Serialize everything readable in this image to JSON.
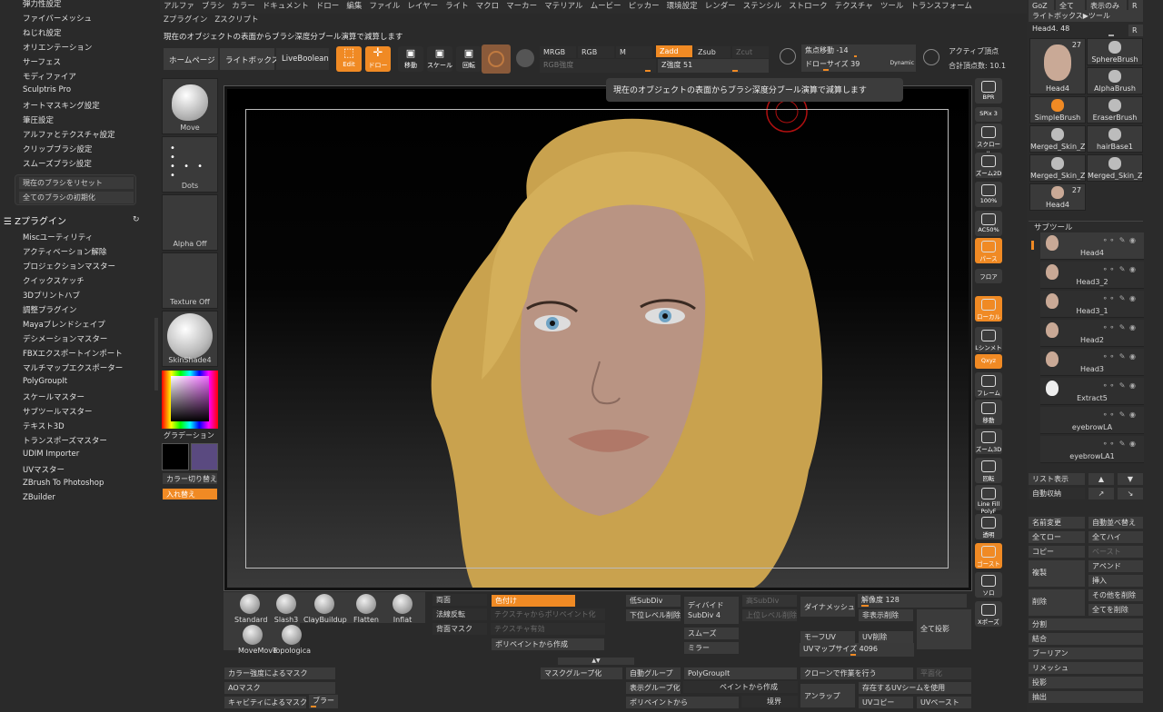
{
  "menubar": [
    "アルファ",
    "ブラシ",
    "カラー",
    "ドキュメント",
    "ドロー",
    "編集",
    "ファイル",
    "レイヤー",
    "ライト",
    "マクロ",
    "マーカー",
    "マテリアル",
    "ムービー",
    "ピッカー",
    "環境設定",
    "レンダー",
    "ステンシル",
    "ストローク",
    "テクスチャ",
    "ツール",
    "トランスフォーム",
    "Zプラグイン",
    "Zスクリプト"
  ],
  "hint": "現在のオブジェクトの表面からブラシ深度分ブール演算で減算します",
  "tooltip": "現在のオブジェクトの表面からブラシ深度分ブール演算で減算します",
  "left_menu": [
    "弾力性設定",
    "ファイバーメッシュ",
    "ねじれ設定",
    "オリエンテーション",
    "サーフェス",
    "モディファイア",
    "Sculptris Pro",
    "オートマスキング設定",
    "筆圧設定",
    "アルファとテクスチャ設定",
    "クリップブラシ設定",
    "スムーズブラシ設定"
  ],
  "reset": [
    "現在のブラシをリセット",
    "全てのブラシの初期化"
  ],
  "zplugin_title": "Zプラグイン",
  "plugins": [
    "Miscユーティリティ",
    "アクティベーション解除",
    "プロジェクションマスター",
    "クイックスケッチ",
    "3Dプリントハブ",
    "調整プラグイン",
    "Mayaブレンドシェイプ",
    "デシメーションマスター",
    "FBXエクスポートインポート",
    "マルチマップエクスポーター",
    "PolyGroupIt",
    "スケールマスター",
    "サブツールマスター",
    "テキスト3D",
    "トランスポーズマスター",
    "UDIM Importer",
    "UVマスター",
    "ZBrush To Photoshop",
    "ZBuilder"
  ],
  "shelf": {
    "home": "ホームページ",
    "lightbox": "ライトボックス",
    "liveboolean": "LiveBoolean",
    "edit": "Edit",
    "draw": "ドロー",
    "move": "移動",
    "scale": "スケール",
    "rotate": "回転",
    "mrgb": "MRGB",
    "rgb": "RGB",
    "m": "M",
    "zadd": "Zadd",
    "zsub": "Zsub",
    "zcut": "Zcut",
    "rgb_intensity": "RGB強度",
    "z_intensity": "Z強度 51",
    "focal": "焦点移動 -14",
    "draw_size": "ドローサイズ 39",
    "dynamic": "Dynamic",
    "active_points": "アクティブ頂点",
    "total_points": "合計頂点数: 10.1"
  },
  "left_tiles": {
    "move": "Move",
    "dots": "Dots",
    "alpha": "Alpha Off",
    "texture": "Texture Off",
    "material": "SkinShade4",
    "gradient": "グラデーション",
    "swap": "カラー切り替え",
    "replace": "入れ替え"
  },
  "right_tools": [
    "BPR",
    "SPix 3",
    "スクロール",
    "ズーム2D",
    "100%",
    "AC50%",
    "パース",
    "フロア",
    "ローカル",
    "Lシンメトリ",
    "Qxyz",
    "フレーム",
    "移動",
    "ズーム3D",
    "回転",
    "Line Fill PolyF",
    "透明",
    "ゴースト",
    "ソロ",
    "Xポーズ"
  ],
  "right_panel": {
    "goz": "GoZ",
    "all": "全て",
    "visible": "表示のみ",
    "r": "R",
    "lightbox_tool": "ライトボックス▶ツール",
    "head_name": "Head4. 48",
    "tools": [
      {
        "name": "Head4",
        "count": "27"
      },
      {
        "name": "SphereBrush"
      },
      {
        "name": "AlphaBrush"
      },
      {
        "name": "SimpleBrush"
      },
      {
        "name": "EraserBrush"
      },
      {
        "name": "Merged_Skin_ZS"
      },
      {
        "name": "hairBase1"
      },
      {
        "name": "Merged_Skin_ZS"
      },
      {
        "name": "Merged_Skin_ZS"
      },
      {
        "name": "Head4",
        "count": "27"
      }
    ],
    "subtool_title": "サブツール",
    "subtools": [
      "Head4",
      "Head3_2",
      "Head3_1",
      "Head2",
      "Head3",
      "Extract5",
      "eyebrowLA",
      "eyebrowLA1"
    ],
    "list_view": "リスト表示",
    "auto_collapse": "自動収納",
    "rename": "名前変更",
    "auto_reorder": "自動並べ替え",
    "all_low": "全てロー",
    "all_high": "全てハイ",
    "copy": "コピー",
    "paste": "ペースト",
    "append": "アペンド",
    "duplicate": "複製",
    "insert": "挿入",
    "delete": "削除",
    "delete_other": "その他を削除",
    "delete_all": "全てを削除",
    "split": "分割",
    "merge": "結合",
    "boolean": "ブーリアン",
    "remesh": "リメッシュ",
    "project": "投影",
    "extract": "抽出"
  },
  "bottom": {
    "brushes": [
      "Standard",
      "Slash3",
      "ClayBuildup",
      "Flatten",
      "Inflat",
      "MoveMove",
      "Topologica"
    ],
    "double": "両面",
    "flip": "法線反転",
    "back_mask": "背面マスク",
    "colorize": "色付け",
    "tex_to_poly": "テクスチャからポリペイント化",
    "tex_on": "テクスチャ有効",
    "from_polypaint": "ポリペイントから作成",
    "lower_subdiv": "低SubDiv",
    "delete_lower": "下位レベル削除",
    "divide": "ディバイド",
    "subdiv": "SubDiv 4",
    "higher_subdiv": "高SubDiv",
    "delete_higher": "上位レベル削除",
    "smooth": "スムーズ",
    "mirror": "ミラー",
    "dynamesh": "ダイナメッシュ",
    "resolution": "解像度 128",
    "morph_uv": "モーフUV",
    "hide": "非表示削除",
    "uv_delete": "UV削除",
    "uv_map_size": "UVマップサイズ 4096",
    "project_all": "全て投影",
    "mask_intensity": "カラー強度によるマスク",
    "ao_mask": "AOマスク",
    "cavity_mask": "キャビティによるマスク",
    "blur": "ブラー",
    "mask_group": "マスクグループ化",
    "auto_group": "自動グループ",
    "polygroupit": "PolyGroupIt",
    "clone_work": "クローンで作業を行う",
    "planar": "平面化",
    "vis_group": "表示グループ化",
    "from_paint": "ペイントから作成",
    "use_uv_seam": "存在するUVシームを使用",
    "from_polypaint2": "ポリペイントから",
    "border": "境界",
    "unwrap": "アンラップ",
    "uv_copy": "UVコピー",
    "uv_paste": "UVペースト"
  },
  "colors": {
    "accent": "#f08a24",
    "hair": "#c9a24e",
    "skin": "#b99483",
    "eye": "#6fa3c4"
  }
}
